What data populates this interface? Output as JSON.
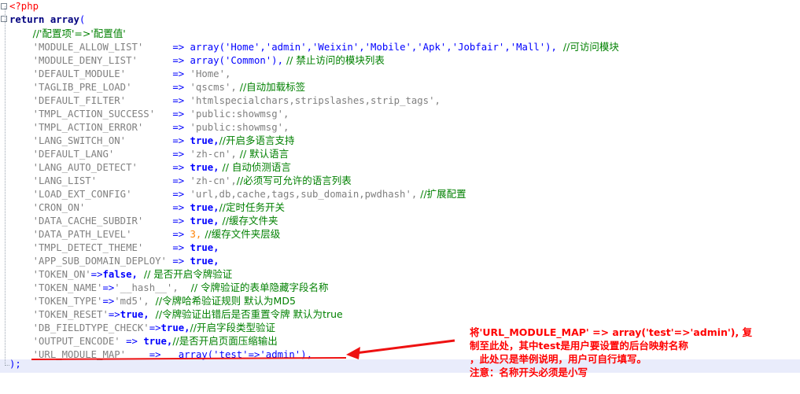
{
  "code": {
    "open_tag": "<?php",
    "return_kw": "return",
    "array_kw": "array",
    "comment_header": "//'配置项'=>'配置值'",
    "close": ");",
    "lines": [
      {
        "key": "'MODULE_ALLOW_LIST'",
        "pad": "     ",
        "arrow": "=>",
        "value": "array('Home','admin','Weixin','Mobile','Apk','Jobfair','Mall'),",
        "comment": "  //可访问模块"
      },
      {
        "key": "'MODULE_DENY_LIST'",
        "pad": "      ",
        "arrow": "=>",
        "value": "array('Common'),",
        "comment": " // 禁止访问的模块列表"
      },
      {
        "key": "'DEFAULT_MODULE'",
        "pad": "        ",
        "arrow": "=>",
        "value": "'Home',",
        "comment": ""
      },
      {
        "key": "'TAGLIB_PRE_LOAD'",
        "pad": "       ",
        "arrow": "=>",
        "value": "'qscms',",
        "comment": " //自动加载标签"
      },
      {
        "key": "'DEFAULT_FILTER'",
        "pad": "        ",
        "arrow": "=>",
        "value": "'htmlspecialchars,stripslashes,strip_tags',",
        "comment": ""
      },
      {
        "key": "'TMPL_ACTION_SUCCESS'",
        "pad": "   ",
        "arrow": "=>",
        "value": "'public:showmsg',",
        "comment": ""
      },
      {
        "key": "'TMPL_ACTION_ERROR'",
        "pad": "     ",
        "arrow": "=>",
        "value": "'public:showmsg',",
        "comment": ""
      },
      {
        "key": "'LANG_SWITCH_ON'",
        "pad": "        ",
        "arrow": "=>",
        "value": "true,",
        "comment": "//开启多语言支持"
      },
      {
        "key": "'DEFAULT_LANG'",
        "pad": "          ",
        "arrow": "=>",
        "value": "'zh-cn',",
        "comment": " // 默认语言"
      },
      {
        "key": "'LANG_AUTO_DETECT'",
        "pad": "      ",
        "arrow": "=>",
        "value": "true,",
        "comment": " // 自动侦测语言"
      },
      {
        "key": "'LANG_LIST'",
        "pad": "             ",
        "arrow": "=>",
        "value": "'zh-cn',",
        "comment": "//必须写可允许的语言列表"
      },
      {
        "key": "'LOAD_EXT_CONFIG'",
        "pad": "       ",
        "arrow": "=>",
        "value": "'url,db,cache,tags,sub_domain,pwdhash',",
        "comment": " //扩展配置"
      },
      {
        "key": "'CRON_ON'",
        "pad": "               ",
        "arrow": "=>",
        "value": "true,",
        "comment": "//定时任务开关"
      },
      {
        "key": "'DATA_CACHE_SUBDIR'",
        "pad": "     ",
        "arrow": "=>",
        "value": "true,",
        "comment": " //缓存文件夹"
      },
      {
        "key": "'DATA_PATH_LEVEL'",
        "pad": "       ",
        "arrow": "=>",
        "value": "3,",
        "comment": " //缓存文件夹层级"
      },
      {
        "key": "'TMPL_DETECT_THEME'",
        "pad": "     ",
        "arrow": "=>",
        "value": "true,",
        "comment": ""
      },
      {
        "key": "'APP_SUB_DOMAIN_DEPLOY'",
        "pad": " ",
        "arrow": "=>",
        "value": "true,",
        "comment": ""
      },
      {
        "key": "'TOKEN_ON'",
        "pad": "",
        "arrow": "=>",
        "value": "false,",
        "comment": "  // 是否开启令牌验证"
      },
      {
        "key": "'TOKEN_NAME'",
        "pad": "",
        "arrow": "=>",
        "value": "'__hash__',",
        "comment": "    // 令牌验证的表单隐藏字段名称"
      },
      {
        "key": "'TOKEN_TYPE'",
        "pad": "",
        "arrow": "=>",
        "value": "'md5',",
        "comment": "  //令牌哈希验证规则 默认为MD5"
      },
      {
        "key": "'TOKEN_RESET'",
        "pad": "",
        "arrow": "=>",
        "value": "true,",
        "comment": "  //令牌验证出错后是否重置令牌 默认为true"
      },
      {
        "key": "'DB_FIELDTYPE_CHECK'",
        "pad": "",
        "arrow": "=>",
        "value": "true,",
        "comment": "//开启字段类型验证"
      },
      {
        "key": "'OUTPUT_ENCODE'",
        "pad": " ",
        "arrow": "=>",
        "value": "true,",
        "comment": "//是否开启页面压缩输出"
      },
      {
        "key": "'URL_MODULE_MAP'",
        "pad": "    ",
        "arrow": "=>",
        "value": "  array('test'=>'admin'),",
        "comment": ""
      }
    ]
  },
  "annotation": {
    "line1": "将'URL_MODULE_MAP'   =>   array('test'=>'admin'), 复",
    "line2": "制至此处，其中test是用户要设置的后台映射名称",
    "line3": "，此处只是举例说明，用户可自行填写。",
    "line4": "注意：名称开头必须是小写"
  },
  "colors": {
    "string": "#808080",
    "keyword": "#00007f",
    "operator": "#0000ff",
    "comment": "#008000",
    "number": "#ff8000",
    "annotation": "#ff0000"
  }
}
